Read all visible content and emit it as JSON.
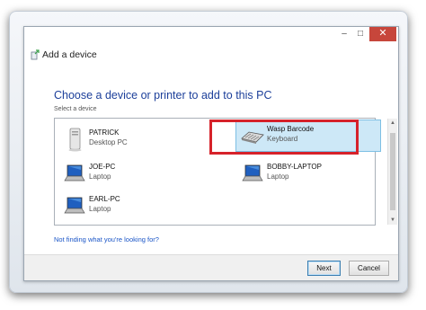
{
  "window": {
    "title": "Add a device",
    "controls": {
      "minimize": "–",
      "maximize": "□",
      "close": "✕"
    }
  },
  "content": {
    "heading": "Choose a device or printer to add to this PC",
    "select_label": "Select a device",
    "devices": [
      {
        "name": "PATRICK",
        "type": "Desktop PC",
        "icon": "desktop-pc-icon"
      },
      {
        "name": "Wasp Barcode",
        "type": "Keyboard",
        "icon": "keyboard-icon",
        "selected": true
      },
      {
        "name": "JOE-PC",
        "type": "Laptop",
        "icon": "laptop-icon"
      },
      {
        "name": "BOBBY-LAPTOP",
        "type": "Laptop",
        "icon": "laptop-icon"
      },
      {
        "name": "EARL-PC",
        "type": "Laptop",
        "icon": "laptop-icon"
      }
    ],
    "help_link": "Not finding what you're looking for?"
  },
  "buttons": {
    "next": "Next",
    "cancel": "Cancel"
  },
  "colors": {
    "heading": "#1c3f9a",
    "selection": "#cde8f7",
    "annotation_box": "#d6222a",
    "close_button": "#c7463b"
  }
}
